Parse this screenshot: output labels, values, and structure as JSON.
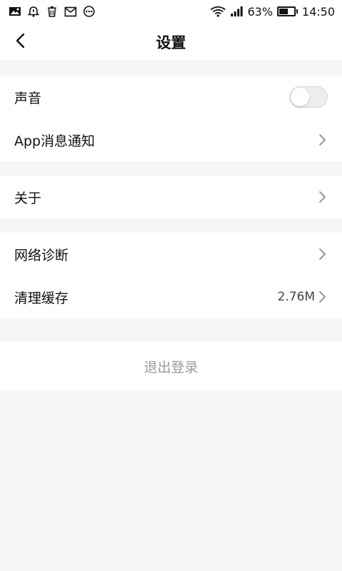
{
  "status_bar": {
    "battery_percent": "63%",
    "battery_level": 0.63,
    "time": "14:50",
    "left_icons": [
      "image-icon",
      "alarm-icon",
      "trash-icon",
      "mail-icon",
      "more-dots-icon"
    ],
    "right_icons": [
      "wifi-icon",
      "signal-icon",
      "battery-icon"
    ]
  },
  "header": {
    "title": "设置",
    "back_icon": "back-arrow-icon"
  },
  "sections": {
    "sound_label": "声音",
    "sound_enabled": false,
    "notification_label": "App消息通知",
    "about_label": "关于",
    "network_label": "网络诊断",
    "cache_label": "清理缓存",
    "cache_value": "2.76M"
  },
  "logout": {
    "label": "退出登录"
  },
  "colors": {
    "background": "#f6f6f6",
    "card": "#ffffff",
    "logout_text": "#9a9a9a",
    "toggle_off": "#ededed"
  }
}
